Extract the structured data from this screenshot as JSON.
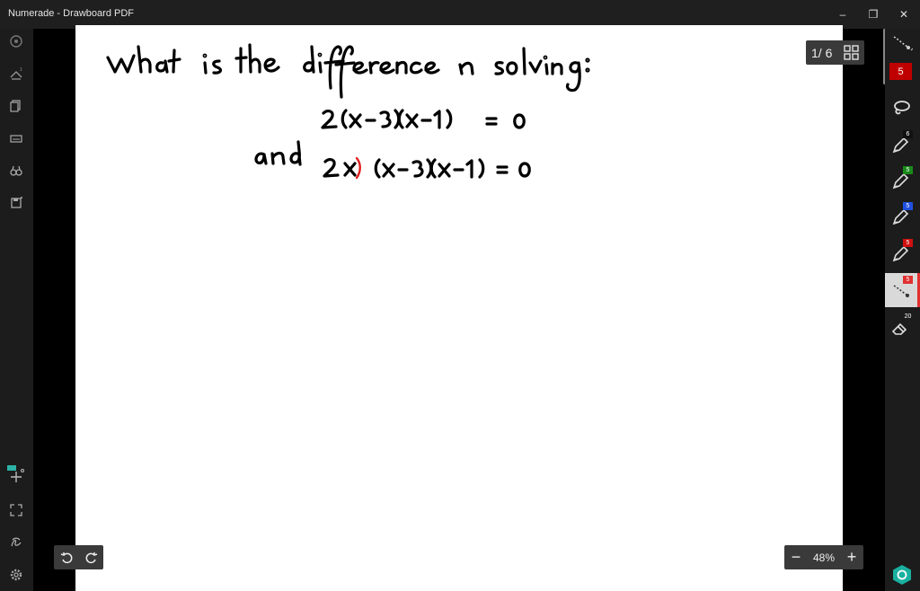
{
  "window": {
    "title": "Numerade - Drawboard PDF",
    "minimize_label": "–",
    "restore_label": "❐",
    "close_label": "✕"
  },
  "page_indicator": {
    "text": "1/ 6",
    "grid_icon": "grid-icon"
  },
  "zoom": {
    "minus_label": "−",
    "level": "48%",
    "plus_label": "+"
  },
  "ink_color": {
    "value": "5",
    "color": "#c00000"
  },
  "right_tools": [
    {
      "name": "lasso-tool",
      "badge": ""
    },
    {
      "name": "pen-tool",
      "badge": "6",
      "badge_color": "#111111"
    },
    {
      "name": "pen-tool",
      "badge": "5",
      "badge_color": "#1a8a1a"
    },
    {
      "name": "pen-tool",
      "badge": "5",
      "badge_color": "#2050e0"
    },
    {
      "name": "pen-tool",
      "badge": "5",
      "badge_color": "#d01010"
    },
    {
      "name": "dotted-line-tool",
      "badge": "5",
      "badge_color": "#d01010"
    },
    {
      "name": "eraser-tool",
      "badge": "20",
      "badge_color": ""
    }
  ],
  "colors": {
    "ink": "#000000",
    "highlight_ink": "#e02020",
    "accent": "#e03030",
    "toolbar_bg": "#1c1c1c",
    "settings_accent": "#1ab0a0"
  }
}
